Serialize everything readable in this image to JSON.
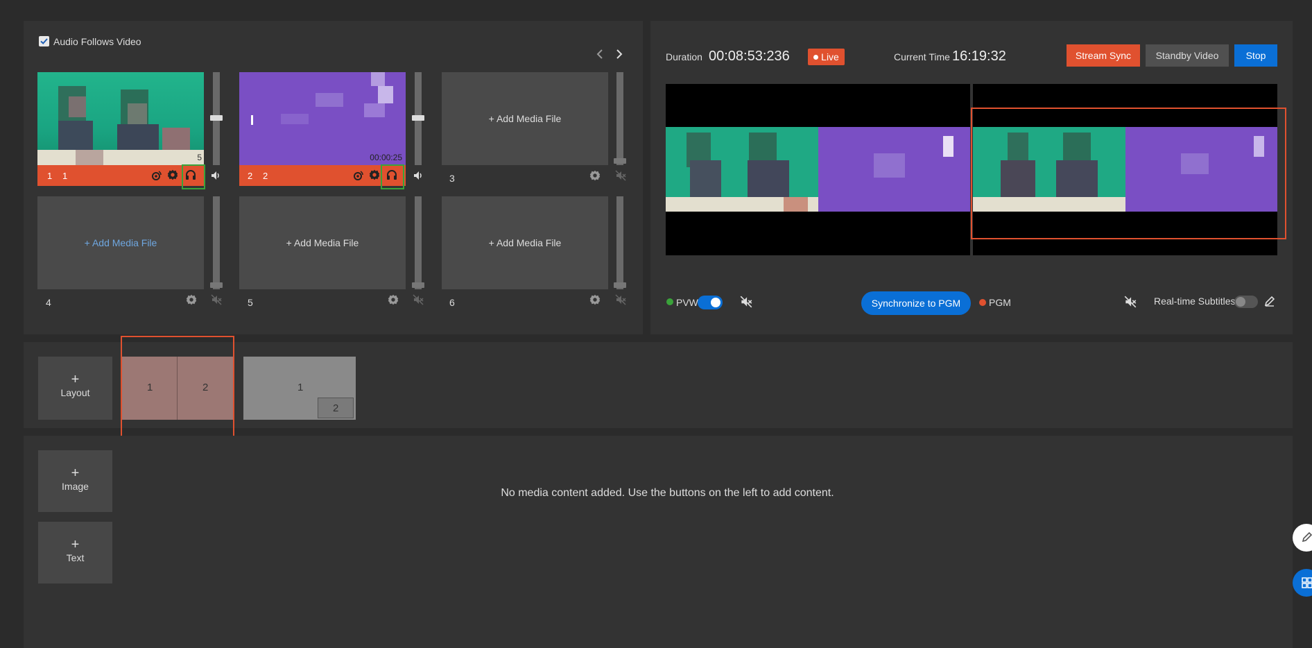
{
  "source_panel": {
    "audio_follows_video": {
      "label": "Audio Follows Video",
      "checked": true
    },
    "nav": {
      "prev_icon": "chevron-left-icon",
      "next_icon": "chevron-right-icon"
    },
    "tiles": [
      {
        "index_label": "1",
        "name_label": "1",
        "has_media": true,
        "time": "5",
        "live": true
      },
      {
        "index_label": "2",
        "name_label": "2",
        "has_media": true,
        "time": "00:00:25",
        "live": true
      },
      {
        "index_label": "3",
        "add_label": "+ Add Media File",
        "has_media": false
      },
      {
        "index_label": "4",
        "add_label": "+ Add Media File",
        "has_media": false,
        "highlight": true
      },
      {
        "index_label": "5",
        "add_label": "+ Add Media File",
        "has_media": false
      },
      {
        "index_label": "6",
        "add_label": "+ Add Media File",
        "has_media": false
      }
    ]
  },
  "monitor_panel": {
    "duration_label": "Duration",
    "duration_value": "00:08:53:236",
    "live_badge": "Live",
    "current_time_label": "Current Time",
    "current_time_value": "16:19:32",
    "buttons": {
      "stream_sync": "Stream Sync",
      "standby_video": "Standby Video",
      "stop": "Stop"
    },
    "pvw_label": "PVW",
    "pgm_label": "PGM",
    "sync_button": "Synchronize to PGM",
    "subtitles_label": "Real-time Subtitles"
  },
  "layout_bar": {
    "add_layout": {
      "plus": "+",
      "label": "Layout"
    },
    "layouts": [
      {
        "cells": [
          "1",
          "2"
        ],
        "selected": true
      },
      {
        "cells": [
          "1",
          "2"
        ],
        "selected": false
      }
    ]
  },
  "media_bar": {
    "add_image": {
      "plus": "+",
      "label": "Image"
    },
    "add_text": {
      "plus": "+",
      "label": "Text"
    },
    "empty_message": "No media content added. Use the buttons on the left to add content."
  },
  "colors": {
    "accent_red": "#e0512f",
    "accent_blue": "#0a6fd6",
    "live_green": "#3aa33a",
    "panel_bg": "#333333",
    "page_bg": "#2b2b2b"
  }
}
